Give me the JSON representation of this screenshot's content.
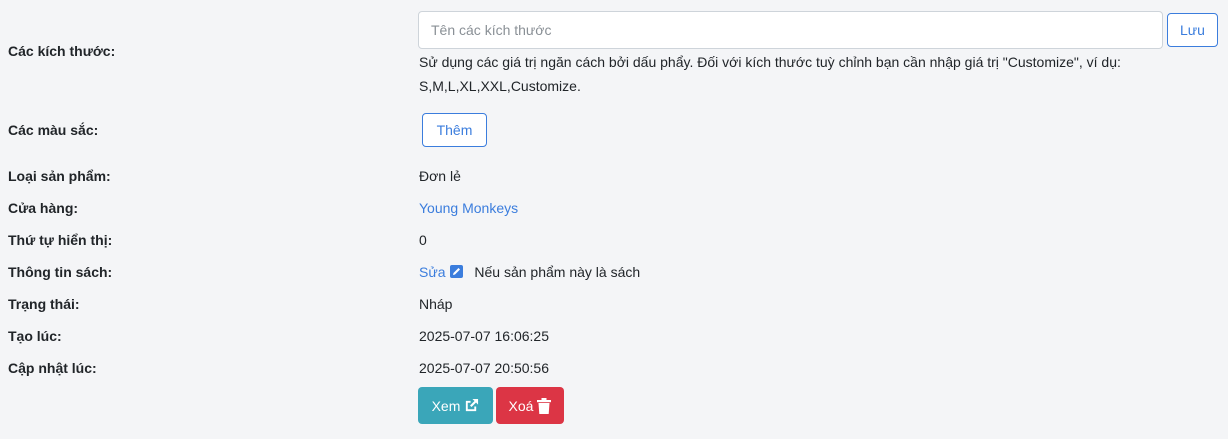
{
  "sizes": {
    "label": "Các kích thước:",
    "input_placeholder": "Tên các kích thước",
    "input_value": "",
    "save_label": "Lưu",
    "help_text": "Sử dụng các giá trị ngăn cách bởi dấu phẩy. Đối với kích thước tuỳ chỉnh bạn cần nhập giá trị \"Customize\", ví dụ: S,M,L,XL,XXL,Customize."
  },
  "colors": {
    "label": "Các màu sắc:",
    "add_label": "Thêm"
  },
  "product_type": {
    "label": "Loại sản phẩm:",
    "value": "Đơn lẻ"
  },
  "store": {
    "label": "Cửa hàng:",
    "value": "Young Monkeys"
  },
  "display_order": {
    "label": "Thứ tự hiển thị:",
    "value": "0"
  },
  "book_info": {
    "label": "Thông tin sách:",
    "edit_label": "Sửa",
    "edit_icon": "pen-square-icon",
    "note": "Nếu sản phẩm này là sách"
  },
  "status": {
    "label": "Trạng thái:",
    "value": "Nháp"
  },
  "created_at": {
    "label": "Tạo lúc:",
    "value": "2025-07-07 16:06:25"
  },
  "updated_at": {
    "label": "Cập nhật lúc:",
    "value": "2025-07-07 20:50:56"
  },
  "actions": {
    "view_label": "Xem",
    "view_icon": "external-link-icon",
    "delete_label": "Xoá",
    "delete_icon": "trash-icon"
  },
  "theme": {
    "primary": "#3b7ddd",
    "info": "#3aa6b9",
    "danger": "#dc3545",
    "background": "#f4f5f7"
  }
}
